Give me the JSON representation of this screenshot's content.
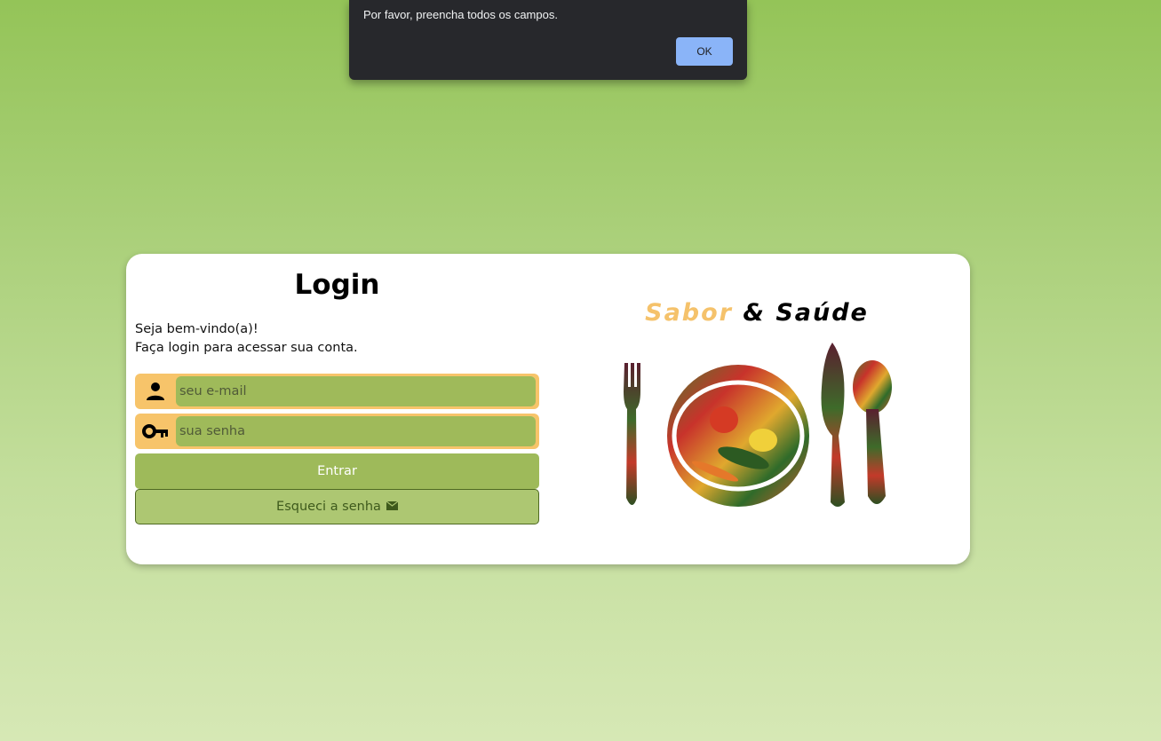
{
  "alert": {
    "message": "Por favor, preencha todos os campos.",
    "ok_label": "OK"
  },
  "login": {
    "title": "Login",
    "welcome_line1": "Seja bem-vindo(a)!",
    "welcome_line2": "Faça login para acessar sua conta.",
    "email_placeholder": "seu e-mail",
    "password_placeholder": "sua senha",
    "submit_label": "Entrar",
    "forgot_label": "Esqueci a senha"
  },
  "brand": {
    "part1": "Sabor",
    "part2": "& Saúde",
    "icon": "plate-cutlery-vegetables-logo"
  },
  "colors": {
    "accent_orange": "#f7c46a",
    "green": "#9eba5a",
    "dialog_button": "#8ab4f8"
  }
}
